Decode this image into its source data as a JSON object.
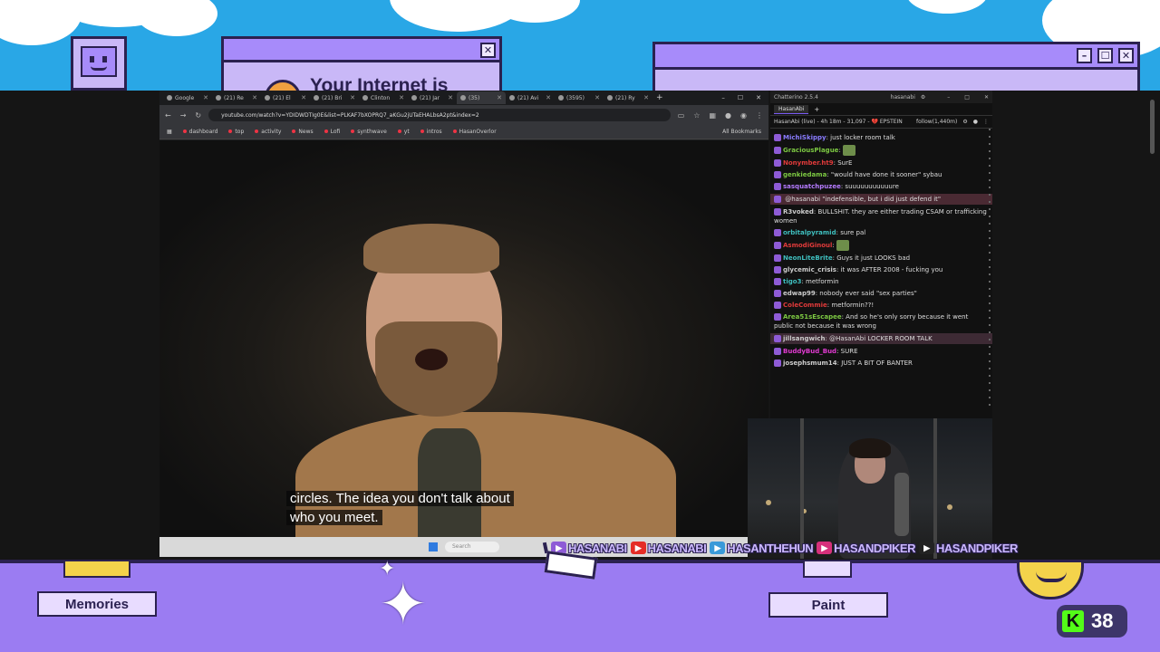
{
  "overlay": {
    "internet_title": "Your Internet is",
    "deco_window_right_buttons": [
      "–",
      "☐",
      "✕"
    ],
    "deco_window_left_close": "✕",
    "bottom_buttons": {
      "memories": "Memories",
      "paint": "Paint"
    },
    "kick_viewers": "38",
    "kick_logo": "K",
    "socials": [
      {
        "platform": "twitch",
        "icon": "twitch-icon",
        "color": "#8e5bd6",
        "handle": "HASANABI"
      },
      {
        "platform": "youtube",
        "icon": "youtube-icon",
        "color": "#e52d27",
        "handle": "HASANABI"
      },
      {
        "platform": "twitter",
        "icon": "twitter-icon",
        "color": "#3a9ad9",
        "handle": "HASANTHEHUN"
      },
      {
        "platform": "instagram",
        "icon": "instagram-icon",
        "color": "#d6307b",
        "handle": "HASANDPIKER"
      },
      {
        "platform": "tiktok",
        "icon": "tiktok-icon",
        "color": "#222222",
        "handle": "HASANDPIKER"
      }
    ]
  },
  "browser": {
    "tabs": [
      {
        "label": "Google",
        "active": false
      },
      {
        "label": "(21) Re",
        "active": false
      },
      {
        "label": "(21) El",
        "active": false
      },
      {
        "label": "(21) Bri",
        "active": false
      },
      {
        "label": "Clinton",
        "active": false
      },
      {
        "label": "(21) Jar",
        "active": false
      },
      {
        "label": "(35)",
        "active": true
      },
      {
        "label": "(21) Avi",
        "active": false
      },
      {
        "label": "(3595)",
        "active": false
      },
      {
        "label": "(21) Ry",
        "active": false
      }
    ],
    "new_tab": "+",
    "window_controls": [
      "–",
      "☐",
      "✕"
    ],
    "url": "youtube.com/watch?v=YDIDWDTIg0E&list=PLKAF7bXOPRQ7_aKGu2jUTaEHALbsA2pt&index=2",
    "bookmarks": [
      "dashboard",
      "top",
      "activity",
      "News",
      "Lofi",
      "synthwave",
      "yt",
      "intros",
      "HasanOverlor"
    ],
    "all_bookmarks": "All Bookmarks",
    "caption_lines": [
      "circles. The idea you don't talk about",
      "who you meet."
    ],
    "taskbar_search": "Search"
  },
  "chat": {
    "app_title": "Chatterino 2.5.4",
    "user": "hasanabi",
    "tab": "HasanAbi",
    "header": "HasanAbi (live) - 4h 18m - 31,097 - 💔 EPSTEIN",
    "header_right": "follow(1,440m)",
    "messages": [
      {
        "user": "MichiSkippy",
        "color": "#8a7cff",
        "text": "just locker room talk",
        "hl": ""
      },
      {
        "user": "GraciousPlague",
        "color": "#7cc842",
        "text": "",
        "hl": ""
      },
      {
        "user": "Nonymber.ht9",
        "color": "#e03a3a",
        "text": "SurE",
        "hl": ""
      },
      {
        "user": "genkiedama",
        "color": "#7cc842",
        "text": "\"would have done it sooner\" sybau",
        "hl": ""
      },
      {
        "user": "sasquatchpuzee",
        "color": "#b57bff",
        "text": "suuuuuuuuuuure",
        "hl": ""
      },
      {
        "user": "",
        "color": "#e03a3a",
        "text": "@hasanabi \"indefensible, but i did just defend it\"",
        "hl": "hl"
      },
      {
        "user": "R3voked",
        "color": "#cccccc",
        "text": "BULLSHIT. they are either trading CSAM or trafficking women",
        "hl": ""
      },
      {
        "user": "orbitalpyramid",
        "color": "#3fbfbf",
        "text": "sure pal",
        "hl": ""
      },
      {
        "user": "AsmodiGinoul",
        "color": "#e03a3a",
        "text": "",
        "hl": ""
      },
      {
        "user": "NeonLiteBrite",
        "color": "#3fbfbf",
        "text": "Guys it just LOOKS bad",
        "hl": ""
      },
      {
        "user": "glycemic_crisis",
        "color": "#cccccc",
        "text": "it was AFTER 2008 - fucking you",
        "hl": ""
      },
      {
        "user": "tigo3",
        "color": "#3fbfbf",
        "text": "metformin",
        "hl": ""
      },
      {
        "user": "edwap99",
        "color": "#cccccc",
        "text": "nobody ever said \"sex parties\"",
        "hl": ""
      },
      {
        "user": "ColeCommie",
        "color": "#e03a3a",
        "text": "metformin??!",
        "hl": ""
      },
      {
        "user": "Area51sEscapee",
        "color": "#7cc842",
        "text": "And so he's only sorry because it went public not because it was wrong",
        "hl": ""
      },
      {
        "user": "jillsangwich",
        "color": "#cccccc",
        "text": "@HasanAbi LOCKER ROOM TALK",
        "hl": "hl2"
      },
      {
        "user": "BuddyBud_Bud",
        "color": "#e03ad0",
        "text": "SURE",
        "hl": ""
      },
      {
        "user": "josephsmum14",
        "color": "#cccccc",
        "text": "JUST A BIT OF BANTER",
        "hl": ""
      }
    ]
  }
}
